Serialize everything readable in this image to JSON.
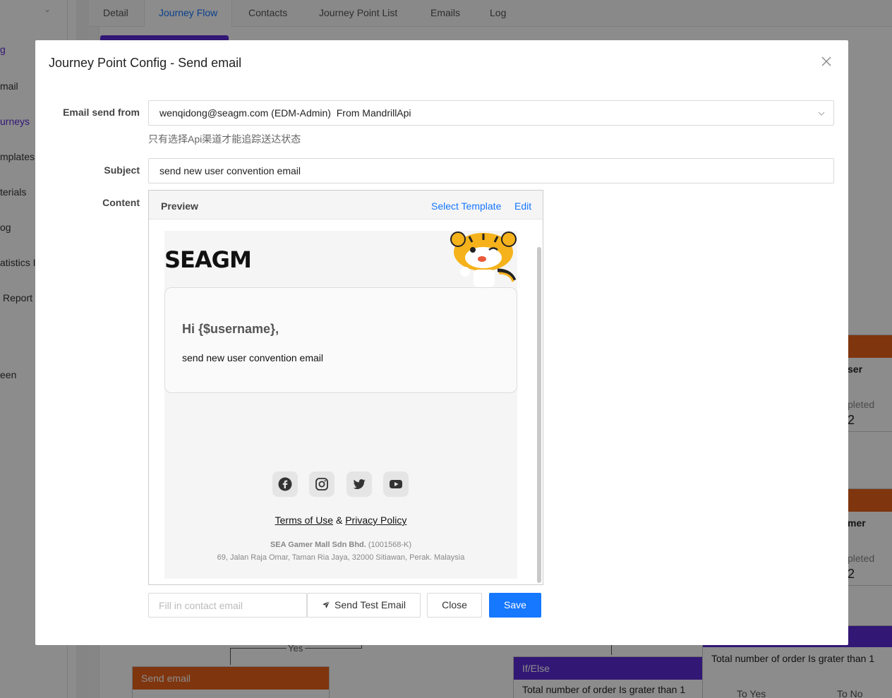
{
  "background": {
    "sidebar_items": [
      {
        "label": "g",
        "active": true
      },
      {
        "label": "mail",
        "active": false
      },
      {
        "label": "urneys",
        "active": true
      },
      {
        "label": "mplates",
        "active": false
      },
      {
        "label": "terials",
        "active": false
      },
      {
        "label": "og",
        "active": false
      },
      {
        "label": "atistics I",
        "active": false
      },
      {
        "label": "Report",
        "active": false
      },
      {
        "label": "een",
        "active": false
      }
    ],
    "tabs": [
      "Detail",
      "Journey Flow",
      "Contacts",
      "Journey Point List",
      "Emails",
      "Log"
    ],
    "active_tab": "Journey Flow",
    "nodes": {
      "send_email_head": "Send email",
      "ifelse_head": "If/Else",
      "ifelse_body": "Total number of order Is grater than 1",
      "right_body": "Total number of order Is grater than 1",
      "to_yes": "To Yes",
      "to_no": "To No",
      "yes_label": "Yes",
      "right_partial_1_title": "ser",
      "right_partial_1_status": "pleted",
      "right_partial_1_value": "2",
      "right_partial_2_title": "mer",
      "right_partial_2_status": "pleted",
      "right_partial_2_value": "2"
    }
  },
  "modal": {
    "title": "Journey Point Config - Send email",
    "email_from_label": "Email send from",
    "email_from_value": "wenqidong@seagm.com (EDM-Admin)  From MandrillApi",
    "email_from_hint": "只有选择Api渠道才能追踪送达状态",
    "subject_label": "Subject",
    "subject_value": "send new user convention email",
    "content_label": "Content",
    "preview_title": "Preview",
    "select_template_link": "Select Template",
    "edit_link": "Edit",
    "email": {
      "logo_text": "SEAGM",
      "greeting": "Hi {$username},",
      "message": "send new user convention email",
      "terms_link": "Terms of Use",
      "and_text": "&",
      "privacy_link": "Privacy Policy",
      "company_name": "SEA Gamer Mall Sdn Bhd.",
      "company_reg": "(1001568-K)",
      "company_address": "69, Jalan Raja Omar, Taman Ria Jaya, 32000 Sitiawan, Perak. Malaysia",
      "social_icons": [
        "facebook-icon",
        "instagram-icon",
        "twitter-icon",
        "youtube-icon"
      ]
    },
    "contact_placeholder": "Fill in contact email",
    "send_test_label": "Send Test Email",
    "close_label": "Close",
    "save_label": "Save"
  },
  "colors": {
    "primary": "#1677ff",
    "brand_purple": "#5b2bd6",
    "node_orange": "#e8621b"
  }
}
